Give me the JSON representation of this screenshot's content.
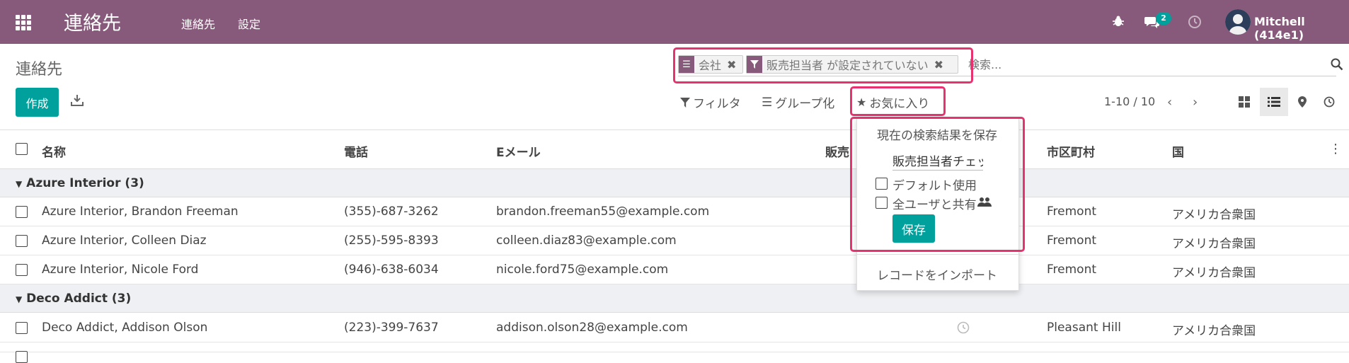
{
  "navbar": {
    "app_title": "連絡先",
    "menu_contacts": "連絡先",
    "menu_settings": "設定",
    "chat_badge": "2",
    "user_name": "Mitchell (414e1)",
    "bg_color": "#875a7b"
  },
  "control_panel": {
    "breadcrumb": "連絡先",
    "create_label": "作成",
    "facets": [
      {
        "icon": "list-icon",
        "label": "会社"
      },
      {
        "icon": "filter-icon",
        "label": "販売担当者 が設定されていない"
      }
    ],
    "search_placeholder": "検索...",
    "filters_label": "フィルタ",
    "groupby_label": "グループ化",
    "favorites_label": "お気に入り",
    "pager": "1-10 / 10",
    "accent_color": "#00a09d",
    "highlight_color": "#e6336f"
  },
  "table": {
    "columns": [
      "名称",
      "電話",
      "Eメール",
      "販売",
      "市区町村",
      "国"
    ],
    "groups": [
      {
        "label": "Azure Interior (3)",
        "rows": [
          {
            "name": "Azure Interior, Brandon Freeman",
            "phone": "(355)-687-3262",
            "email": "brandon.freeman55@example.com",
            "city": "Fremont",
            "country": "アメリカ合衆国"
          },
          {
            "name": "Azure Interior, Colleen Diaz",
            "phone": "(255)-595-8393",
            "email": "colleen.diaz83@example.com",
            "city": "Fremont",
            "country": "アメリカ合衆国"
          },
          {
            "name": "Azure Interior, Nicole Ford",
            "phone": "(946)-638-6034",
            "email": "nicole.ford75@example.com",
            "city": "Fremont",
            "country": "アメリカ合衆国"
          }
        ]
      },
      {
        "label": "Deco Addict (3)",
        "rows": [
          {
            "name": "Deco Addict, Addison Olson",
            "phone": "(223)-399-7637",
            "email": "addison.olson28@example.com",
            "city": "Pleasant Hill",
            "country": "アメリカ合衆国"
          }
        ]
      }
    ]
  },
  "favorites_dropdown": {
    "save_current_search": "現在の検索結果を保存",
    "filter_name_value": "販売担当者チェッ",
    "default_use": "デフォルト使用",
    "share_all_users": "全ユーザと共有",
    "save_label": "保存",
    "import_records": "レコードをインポート"
  }
}
